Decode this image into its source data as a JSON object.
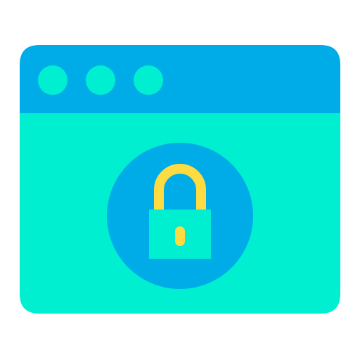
{
  "icon": {
    "name": "browser-lock-icon",
    "parts": {
      "window": "browser-window-icon",
      "dots": [
        "window-dot-icon",
        "window-dot-icon",
        "window-dot-icon"
      ],
      "badge": "lock-badge-icon",
      "lock": "padlock-icon"
    }
  },
  "colors": {
    "title_bar": "#00ACE8",
    "window_body": "#00EFD1",
    "dots": "#00EFD1",
    "badge": "#00ACE8",
    "shackle": "#FEDB41",
    "lock_body": "#00EFD1",
    "keyhole": "#FEDB41",
    "background": "#FFFFFF"
  }
}
